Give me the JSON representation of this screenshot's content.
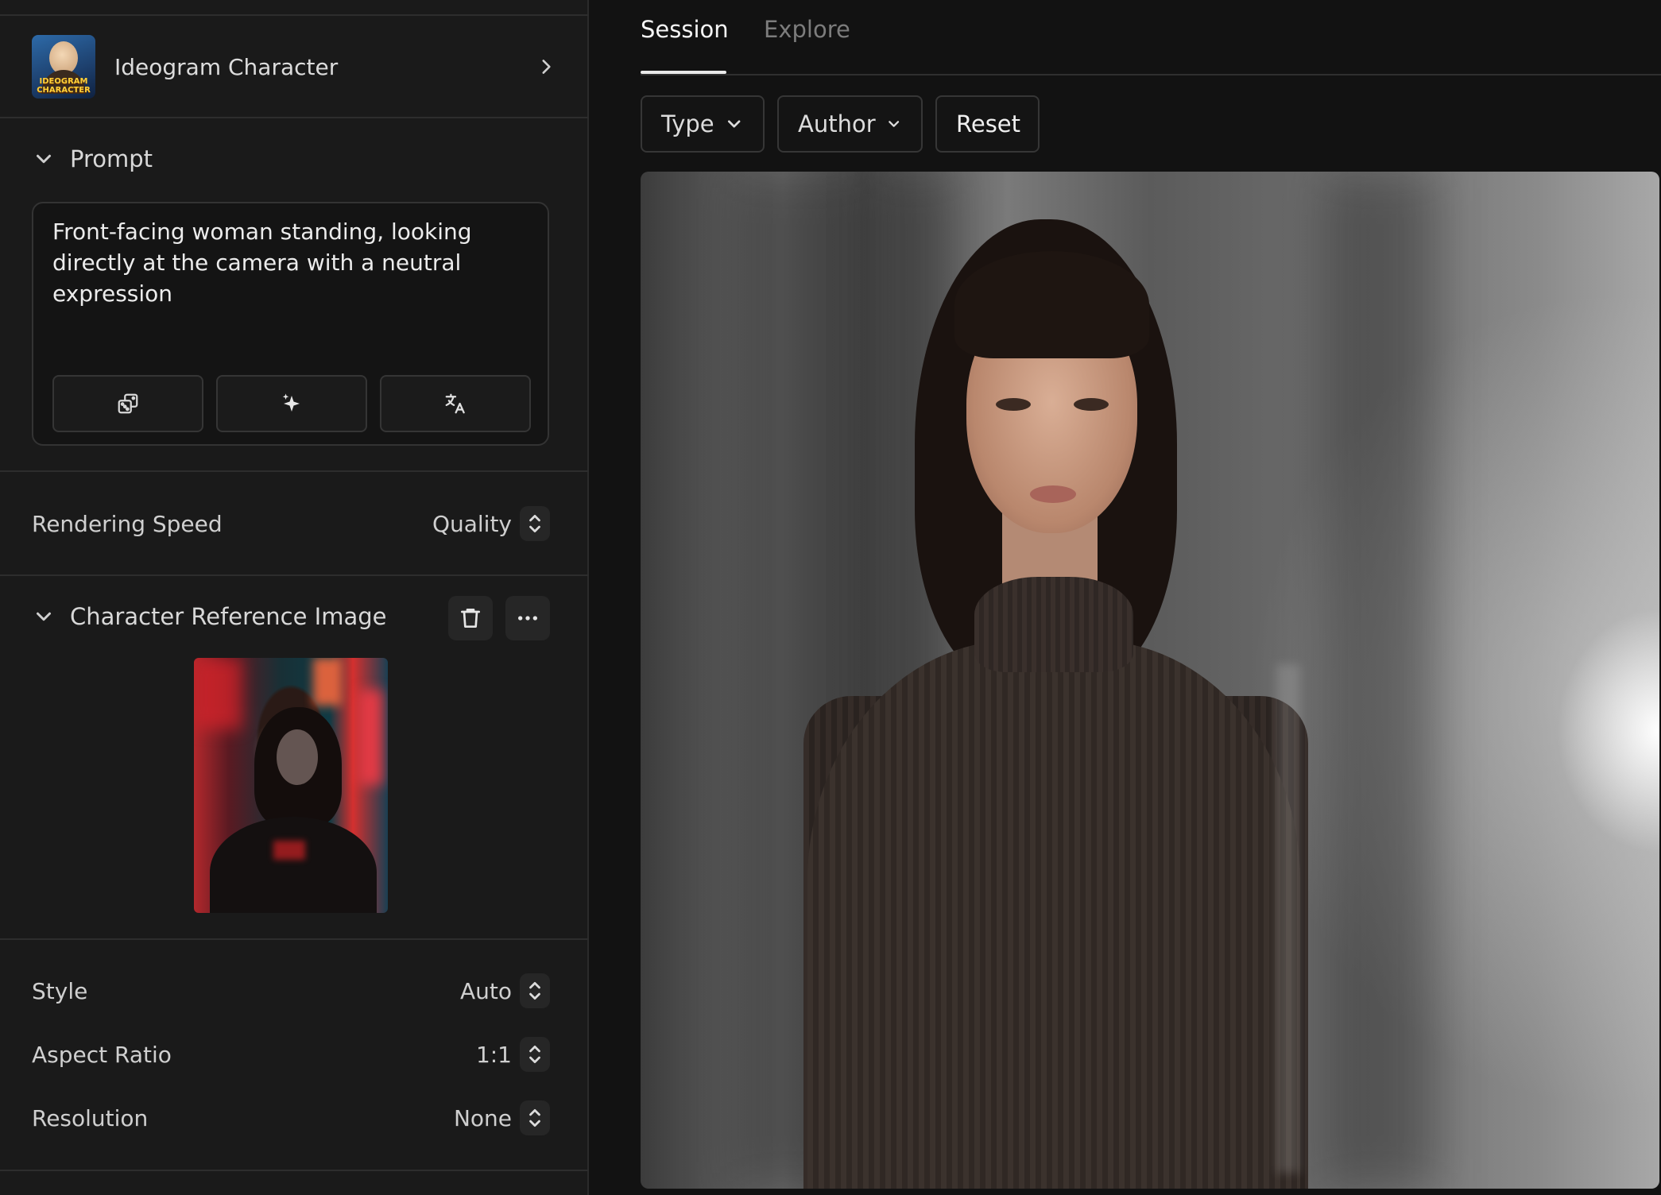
{
  "model": {
    "name": "Ideogram Character",
    "thumb_text": "IDEOGRAM CHARACTER",
    "icon": "chevron-right-icon"
  },
  "prompt": {
    "section_label": "Prompt",
    "text": "Front-facing woman standing, looking directly at the camera with a neutral expression",
    "tools": [
      "dice-icon",
      "magic-sparkle-icon",
      "translate-icon"
    ]
  },
  "rendering_speed": {
    "label": "Rendering Speed",
    "value": "Quality"
  },
  "character_ref": {
    "section_label": "Character Reference Image",
    "actions": [
      "trash-icon",
      "more-options-icon"
    ]
  },
  "settings": {
    "style": {
      "label": "Style",
      "value": "Auto"
    },
    "aspect_ratio": {
      "label": "Aspect Ratio",
      "value": "1:1"
    },
    "resolution": {
      "label": "Resolution",
      "value": "None"
    }
  },
  "tabs": {
    "session": "Session",
    "explore": "Explore",
    "active": "Session"
  },
  "filters": {
    "type": "Type",
    "author": "Author",
    "reset": "Reset"
  },
  "colors": {
    "background": "#121212",
    "sidebar": "#1a1a1a",
    "border": "#2d2d2d",
    "active_tab": "#f5f5f5",
    "inactive_tab": "#7c7c7c"
  }
}
